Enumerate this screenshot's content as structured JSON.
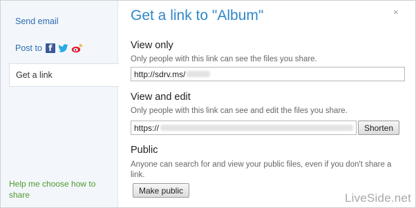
{
  "sidebar": {
    "send_email": "Send email",
    "post_to": "Post to",
    "get_link": "Get a link",
    "help": "Help me choose how to share",
    "social_icons": [
      "facebook-icon",
      "twitter-icon",
      "weibo-icon"
    ],
    "colors": {
      "link": "#2d6cb0",
      "help": "#4e9a2e",
      "facebook": "#3b5998"
    }
  },
  "main": {
    "title": "Get a link to \"Album\"",
    "close": "×",
    "view_only": {
      "heading": "View only",
      "description": "Only people with this link can see the files you share.",
      "link_prefix": "http://sdrv.ms/"
    },
    "view_edit": {
      "heading": "View and edit",
      "description": "Only people with this link can see and edit the files you share.",
      "link_prefix": "https://",
      "shorten_label": "Shorten"
    },
    "public": {
      "heading": "Public",
      "description": "Anyone can search for and view your public files, even if you don't share a link.",
      "make_public_label": "Make public"
    },
    "colors": {
      "title": "#2f87c9"
    }
  },
  "watermark": "LiveSide.net"
}
